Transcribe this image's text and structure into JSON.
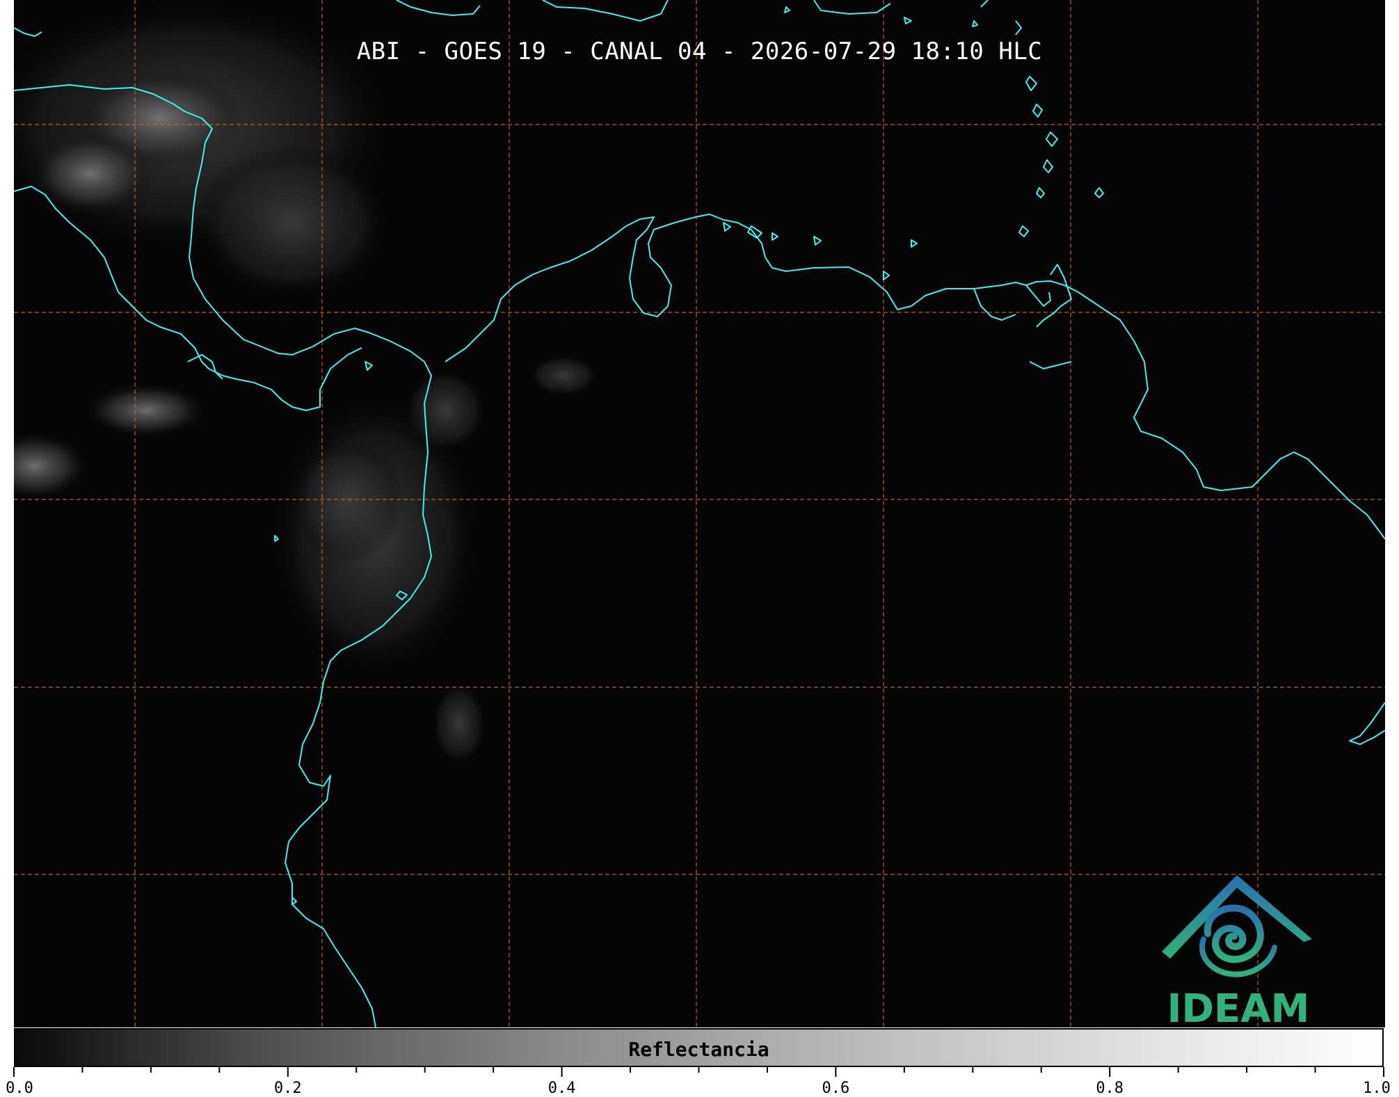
{
  "title": "ABI - GOES 19 - CANAL 04 - 2026-07-29 18:10 HLC",
  "colorbar": {
    "label": "Reflectancia",
    "range": [
      0.0,
      1.0
    ],
    "ticks": [
      "0.0",
      "0.2",
      "0.4",
      "0.6",
      "0.8",
      "1.0"
    ],
    "minor_step": 0.05
  },
  "logo": {
    "text": "IDEAM",
    "icon": "ideam-logo-icon"
  },
  "colors": {
    "coastline": "#3ff0f0",
    "gridline": "#d2691e",
    "background": "#050505",
    "logo_blue": "#2a6fb0",
    "logo_green": "#2fb37a"
  },
  "map": {
    "gridlines": "dashed",
    "coastlines": true
  }
}
